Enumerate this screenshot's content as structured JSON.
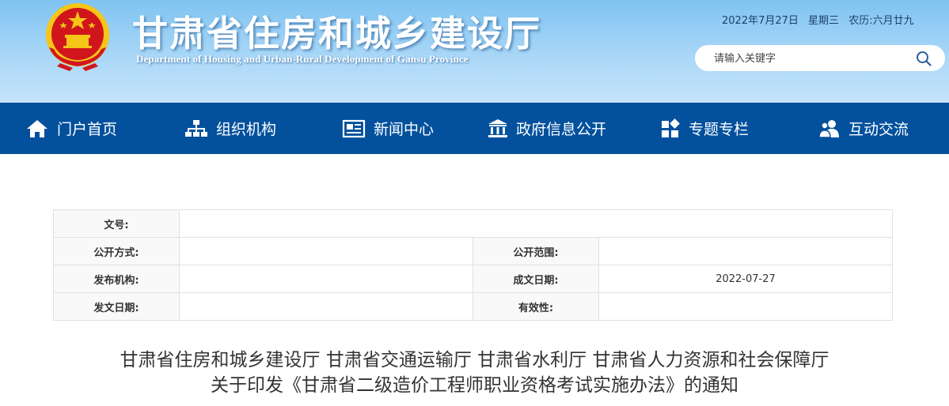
{
  "header": {
    "title_cn": "甘肃省住房和城乡建设厅",
    "title_en": "Department of Housing and Urban-Rural Development of Gansu Province",
    "date": "2022年7月27日",
    "weekday": "星期三",
    "lunar": "农历:六月廿九",
    "search_placeholder": "请输入关键字"
  },
  "nav": {
    "items": [
      {
        "label": "门户首页",
        "icon": "home-icon"
      },
      {
        "label": "组织机构",
        "icon": "org-chart-icon"
      },
      {
        "label": "新闻中心",
        "icon": "news-icon"
      },
      {
        "label": "政府信息公开",
        "icon": "government-building-icon"
      },
      {
        "label": "专题专栏",
        "icon": "grid-icon"
      },
      {
        "label": "互动交流",
        "icon": "users-icon"
      }
    ]
  },
  "info": {
    "doc_number_label": "文号:",
    "doc_number": "",
    "disclosure_mode_label": "公开方式:",
    "disclosure_mode": "",
    "disclosure_scope_label": "公开范围:",
    "disclosure_scope": "",
    "issuer_label": "发布机构:",
    "issuer": "",
    "created_date_label": "成文日期:",
    "created_date": "2022-07-27",
    "issue_date_label": "发文日期:",
    "issue_date": "",
    "validity_label": "有效性:",
    "validity": ""
  },
  "document": {
    "title_line1": "甘肃省住房和城乡建设厅 甘肃省交通运输厅 甘肃省水利厅 甘肃省人力资源和社会保障厅",
    "title_line2": "关于印发《甘肃省二级造价工程师职业资格考试实施办法》的通知"
  },
  "colors": {
    "nav_bg": "#03519d",
    "header_sky": "#a9d7f7",
    "emblem_red": "#d0161c",
    "emblem_gold": "#f5c518"
  }
}
